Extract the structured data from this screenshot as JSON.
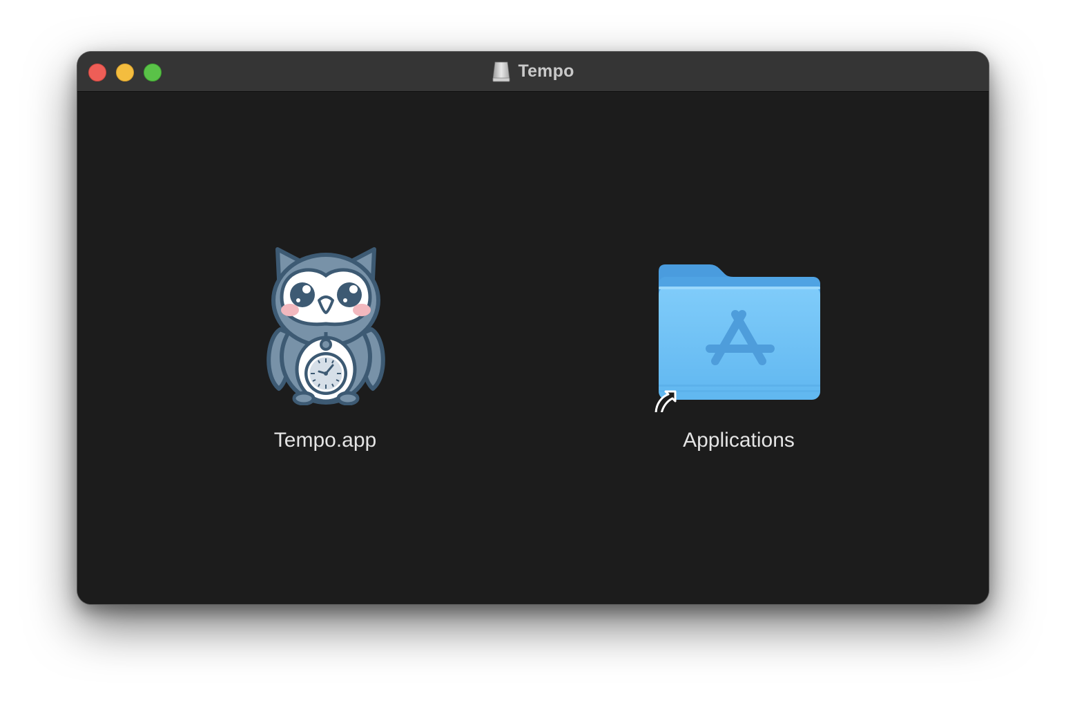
{
  "window": {
    "title": "Tempo",
    "title_icon": "disk-image-icon"
  },
  "traffic_lights": {
    "close_color": "#ee5e57",
    "minimize_color": "#f4bd3f",
    "maximize_color": "#5ac248"
  },
  "items": [
    {
      "label": "Tempo.app",
      "icon": "owl-app-icon"
    },
    {
      "label": "Applications",
      "icon": "applications-folder-alias-icon"
    }
  ],
  "colors": {
    "window_background": "#1c1c1c",
    "titlebar": "#353535",
    "folder_blue": "#6cc3f6",
    "owl_body": "#7892a8",
    "owl_outline": "#3d5a73"
  }
}
